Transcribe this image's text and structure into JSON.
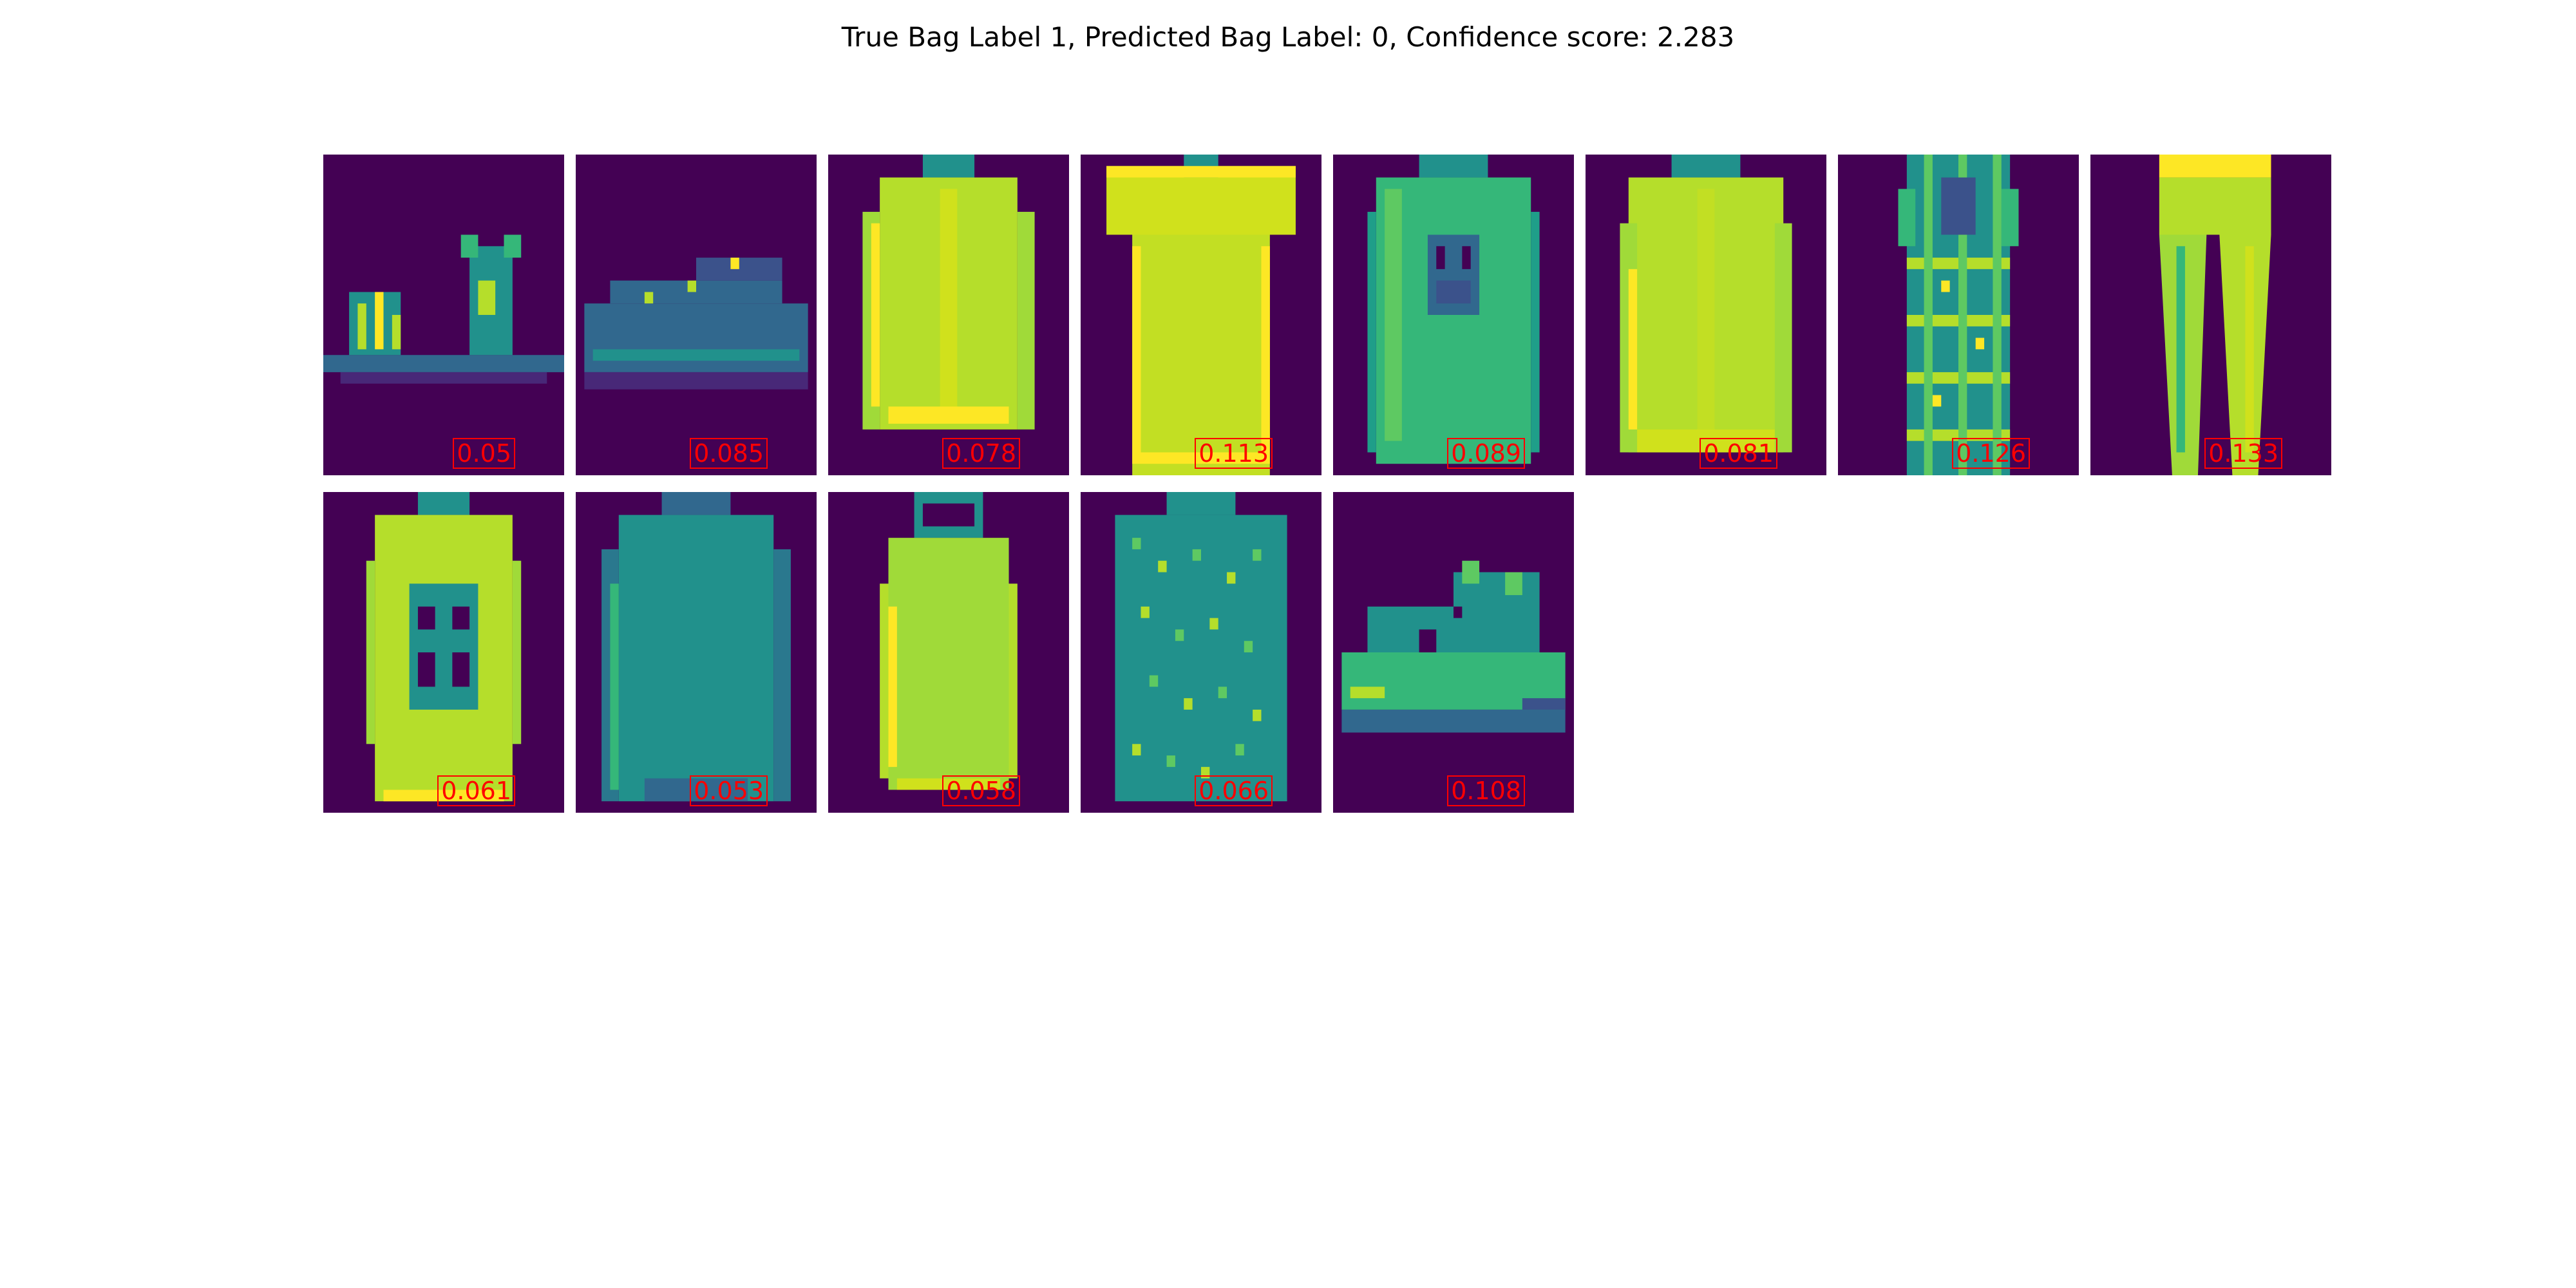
{
  "title": "True Bag Label 1, Predicted Bag Label: 0, Confidence score: 2.283",
  "colors": {
    "background": "#440154",
    "score_text": "#ff0000",
    "dark_teal": "#31688e",
    "teal": "#21918c",
    "green": "#35b779",
    "lime": "#b5de2b",
    "yellow": "#fde725"
  },
  "instances": [
    {
      "item": "sandal",
      "score": "0.05"
    },
    {
      "item": "sneaker",
      "score": "0.085"
    },
    {
      "item": "coat",
      "score": "0.078"
    },
    {
      "item": "t-shirt",
      "score": "0.113"
    },
    {
      "item": "pullover-with-print",
      "score": "0.089"
    },
    {
      "item": "shirt",
      "score": "0.081"
    },
    {
      "item": "plaid-dress",
      "score": "0.126"
    },
    {
      "item": "trouser",
      "score": "0.133"
    },
    {
      "item": "dress-with-print",
      "score": "0.061"
    },
    {
      "item": "long-sleeve-top",
      "score": "0.053"
    },
    {
      "item": "hooded-pullover",
      "score": "0.058"
    },
    {
      "item": "patterned-top",
      "score": "0.066"
    },
    {
      "item": "sneaker",
      "score": "0.108"
    }
  ]
}
